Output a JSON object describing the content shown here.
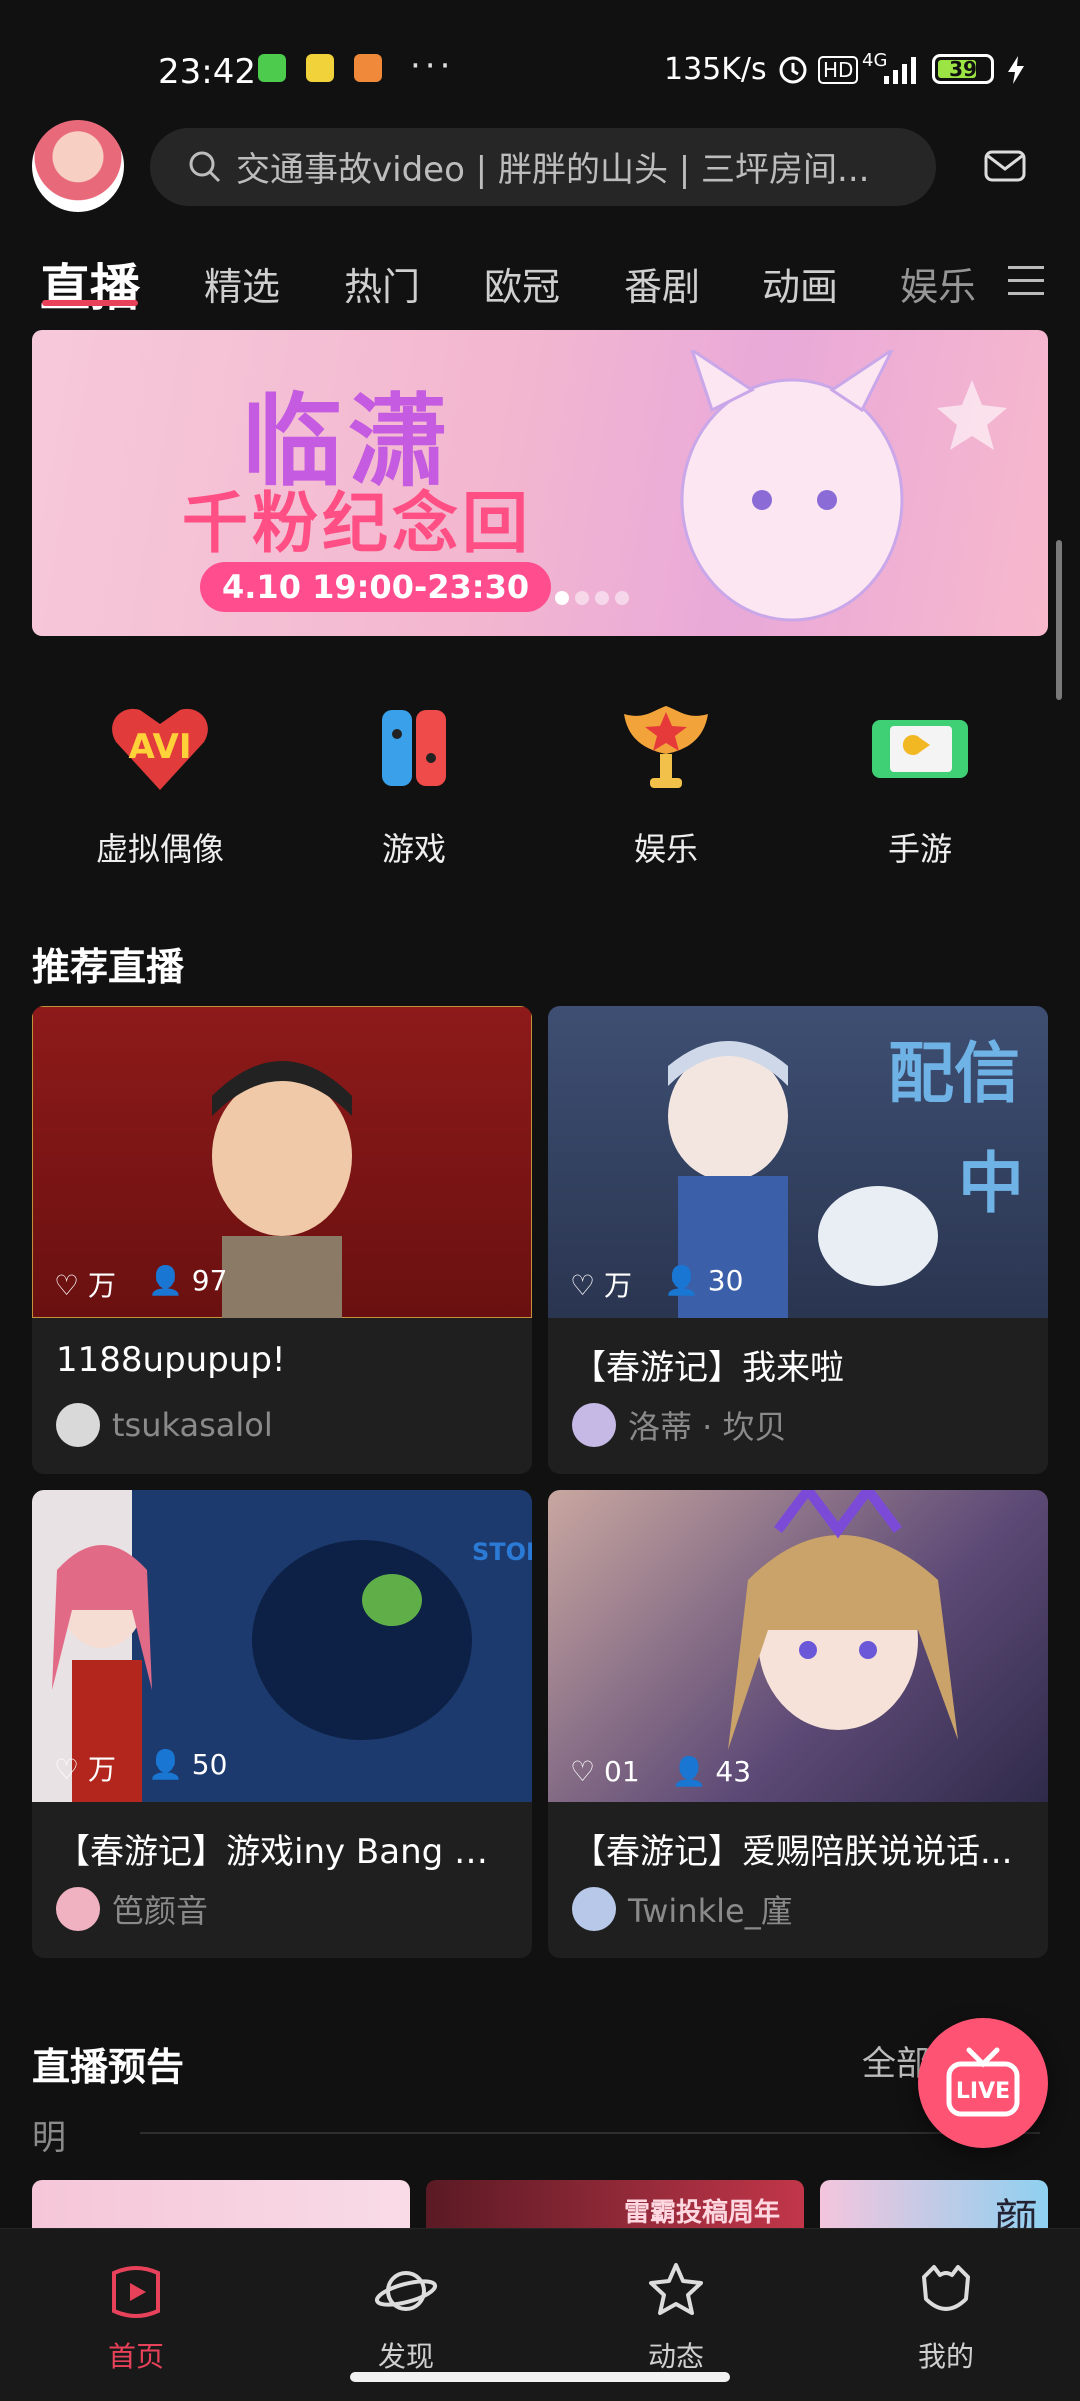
{
  "status_bar": {
    "time": "23:42",
    "more": "···",
    "net_speed": "135K/s",
    "badges": [
      "HD",
      "4G"
    ],
    "battery": "39"
  },
  "header": {
    "search_text": "交通事故video | 胖胖的山头 | 三坪房间...",
    "avatar_icon": "avatar",
    "message_icon": "message-icon"
  },
  "tabs": [
    {
      "label": "直播"
    },
    {
      "label": "精选"
    },
    {
      "label": "热门"
    },
    {
      "label": "欧冠"
    },
    {
      "label": "番剧"
    },
    {
      "label": "动画"
    },
    {
      "label": "娱乐"
    }
  ],
  "banner": {
    "title": "临潇",
    "subtitle": "千粉纪念回",
    "date": "4.10 19:00-23:30"
  },
  "categories": [
    {
      "label": "虚拟偶像",
      "icon": "avi-icon"
    },
    {
      "label": "游戏",
      "icon": "gamepad-icon"
    },
    {
      "label": "娱乐",
      "icon": "trophy-icon"
    },
    {
      "label": "手游",
      "icon": "mobile-game-icon"
    }
  ],
  "recommend": {
    "title": "推荐直播",
    "cards": [
      {
        "title": "1188upupup!",
        "author": "tsukasalol",
        "likes": "万",
        "viewers": "97",
        "accent": "#8e1a1a"
      },
      {
        "title": "【春游记】我来啦",
        "author": "洛蒂 · 坎贝",
        "likes": "万",
        "viewers": "30",
        "accent": "#3e4f73"
      },
      {
        "title": "【春游记】游戏iny Bang St...",
        "author": "笆颜音",
        "likes": "万",
        "viewers": "50",
        "accent": "#1d3a6e"
      },
      {
        "title": "【春游记】爱赐陪朕说说话...",
        "author": "Twinkle_廑",
        "likes": "01",
        "viewers": "43",
        "accent": "#6a4a5e"
      }
    ]
  },
  "preview": {
    "title": "直播预告",
    "more": "全部",
    "day": "明",
    "thumb_caption": "雷霸投稿周年",
    "thumb_right": "颜"
  },
  "live_button": "LIVE",
  "bottom_nav": [
    {
      "label": "首页",
      "icon": "live-home-icon",
      "active": true
    },
    {
      "label": "发现",
      "icon": "planet-icon"
    },
    {
      "label": "动态",
      "icon": "star-face-icon"
    },
    {
      "label": "我的",
      "icon": "profile-icon"
    }
  ],
  "colors": {
    "accent": "#e8425a",
    "background": "#111111",
    "card": "#1f1f1f"
  }
}
